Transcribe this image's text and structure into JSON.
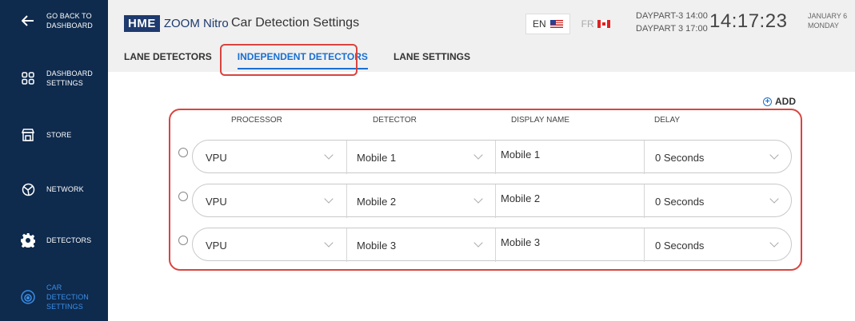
{
  "sidebar": {
    "items": [
      {
        "label": "GO BACK TO DASHBOARD",
        "icon": "arrow-left-icon"
      },
      {
        "label": "DASHBOARD SETTINGS",
        "icon": "grid-icon"
      },
      {
        "label": "STORE",
        "icon": "store-icon"
      },
      {
        "label": "NETWORK",
        "icon": "network-icon"
      },
      {
        "label": "DETECTORS",
        "icon": "gear-icon"
      },
      {
        "label": "CAR DETECTION SETTINGS",
        "icon": "car-detection-icon",
        "active": true
      }
    ]
  },
  "header": {
    "brand_hme": "HME",
    "brand_product": "ZOOM Nitro",
    "title": "Car Detection Settings",
    "lang_en": "EN",
    "lang_fr": "FR",
    "daypart_line1": "DAYPART-3 14:00",
    "daypart_line2": "DAYPART 3 17:00",
    "clock": "14:17:23",
    "date_line1": "JANUARY 6",
    "date_line2": "MONDAY"
  },
  "tabs": [
    {
      "label": "LANE DETECTORS"
    },
    {
      "label": "INDEPENDENT DETECTORS",
      "active": true
    },
    {
      "label": "LANE SETTINGS"
    }
  ],
  "add_label": "ADD",
  "columns": {
    "processor": "PROCESSOR",
    "detector": "DETECTOR",
    "display_name": "DISPLAY NAME",
    "delay": "DELAY"
  },
  "rows": [
    {
      "processor": "VPU",
      "detector": "Mobile 1",
      "display_name": "Mobile 1",
      "delay": "0 Seconds"
    },
    {
      "processor": "VPU",
      "detector": "Mobile 2",
      "display_name": "Mobile 2",
      "delay": "0 Seconds"
    },
    {
      "processor": "VPU",
      "detector": "Mobile 3",
      "display_name": "Mobile 3",
      "delay": "0 Seconds"
    }
  ],
  "colors": {
    "sidebar_bg": "#0e2a4d",
    "accent": "#1a6fd1",
    "highlight": "#d9443f"
  }
}
